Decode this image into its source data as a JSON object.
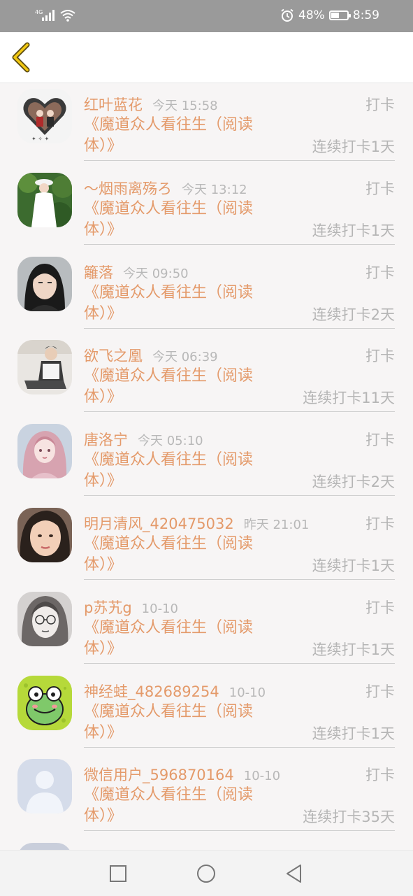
{
  "status_bar": {
    "network": "4G",
    "battery": "48%",
    "battery_level": 0.48,
    "time": "8:59",
    "icons": [
      "signal-icon",
      "wifi-icon",
      "alarm-icon",
      "battery-icon"
    ]
  },
  "header": {
    "back_icon": "chevron-left-icon"
  },
  "items": [
    {
      "name": "红叶蓝花",
      "time": "今天 15:58",
      "tag": "打卡",
      "book": "《魔道众人看往生（阅读体）》",
      "streak": "连续打卡1天",
      "avatar": "avatar-heart-couple"
    },
    {
      "name": "～烟雨离殇ろ",
      "time": "今天 13:12",
      "tag": "打卡",
      "book": "《魔道众人看往生（阅读体）》",
      "streak": "连续打卡1天",
      "avatar": "avatar-girl-forest"
    },
    {
      "name": "籬落",
      "time": "今天 09:50",
      "tag": "打卡",
      "book": "《魔道众人看往生（阅读体）》",
      "streak": "连续打卡2天",
      "avatar": "avatar-dark-hair-man"
    },
    {
      "name": "欲飞之凰",
      "time": "今天 06:39",
      "tag": "打卡",
      "book": "《魔道众人看往生（阅读体）》",
      "streak": "连续打卡11天",
      "avatar": "avatar-sitting-person"
    },
    {
      "name": "唐洛宁",
      "time": "今天 05:10",
      "tag": "打卡",
      "book": "《魔道众人看往生（阅读体）》",
      "streak": "连续打卡2天",
      "avatar": "avatar-pink-anime"
    },
    {
      "name": "明月清风_420475032",
      "time": "昨天 21:01",
      "tag": "打卡",
      "book": "《魔道众人看往生（阅读体）》",
      "streak": "连续打卡1天",
      "avatar": "avatar-face-closeup"
    },
    {
      "name": "p苏艽g",
      "time": "10-10",
      "tag": "打卡",
      "book": "《魔道众人看往生（阅读体）》",
      "streak": "连续打卡1天",
      "avatar": "avatar-sketch-glasses"
    },
    {
      "name": "神经蛙_482689254",
      "time": "10-10",
      "tag": "打卡",
      "book": "《魔道众人看往生（阅读体）》",
      "streak": "连续打卡1天",
      "avatar": "avatar-frog"
    },
    {
      "name": "微信用户_596870164",
      "time": "10-10",
      "tag": "打卡",
      "book": "《魔道众人看往生（阅读体）》",
      "streak": "连续打卡35天",
      "avatar": "avatar-default-user"
    }
  ],
  "nav_bar": {
    "icons": [
      "recent-apps-icon",
      "home-icon",
      "back-triangle-icon"
    ]
  },
  "colors": {
    "accent": "#e49a6a",
    "muted": "#b5b5b5",
    "status_bar": "#9a9a9a"
  }
}
